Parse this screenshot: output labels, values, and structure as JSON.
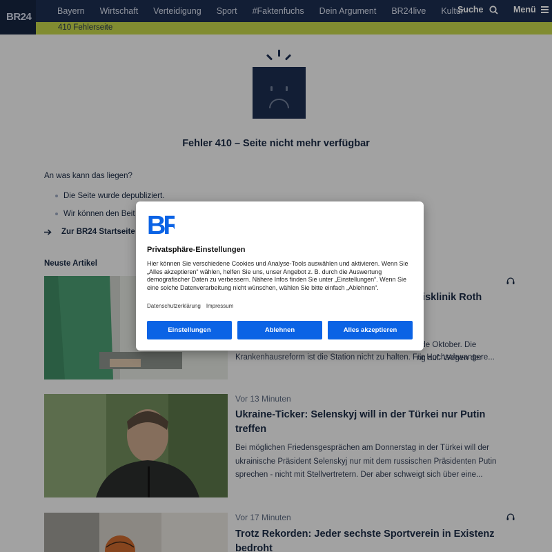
{
  "header": {
    "logo": "BR24",
    "nav": [
      "Bayern",
      "Wirtschaft",
      "Verteidigung",
      "Sport",
      "#Faktenfuchs",
      "Dein Argument",
      "BR24live",
      "Kultur"
    ],
    "search_label": "Suche",
    "menu_label": "Menü",
    "breadcrumb": "410 Fehlerseite"
  },
  "error": {
    "title": "Fehler 410 – Seite nicht mehr verfügbar",
    "question": "An was kann das liegen?",
    "reasons": [
      "Die Seite wurde depubliziert.",
      "Wir können den Beit"
    ],
    "home_link": "Zur BR24 Startseite"
  },
  "articles": {
    "section_title": "Neuste Artikel",
    "items": [
      {
        "meta": "",
        "headline": "eisklinik Roth",
        "teaser": "nde Oktober. Die\nng auf. Wegen der\nKrankenhausreform ist die Station nicht zu halten. Für Hochschwangere..."
      },
      {
        "meta": "Vor 13 Minuten",
        "headline": "Ukraine-Ticker: Selenskyj will in der Türkei nur Putin treffen",
        "teaser": "Bei möglichen Friedensgesprächen am Donnerstag in der Türkei will der ukrainische Präsident Selenskyj nur mit dem russischen Präsidenten Putin sprechen - nicht mit Stellvertretern. Der aber schweigt sich über eine..."
      },
      {
        "meta": "Vor 17 Minuten",
        "headline": "Trotz Rekorden: Jeder sechste Sportverein in Existenz bedroht",
        "teaser": ""
      }
    ]
  },
  "consent": {
    "logo": "BR",
    "title": "Privatsphäre-Einstellungen",
    "text": "Hier können Sie verschiedene Cookies und Analyse-Tools auswählen und aktivieren. Wenn Sie „Alles akzeptieren“ wählen, helfen Sie uns, unser Angebot z. B. durch die Auswertung demografischer Daten zu verbessern. Nähere Infos finden Sie unter „Einstellungen“. Wenn Sie eine solche Datenverarbeitung nicht wünschen, wählen Sie bitte einfach „Ablehnen“.",
    "link_privacy": "Datenschutzerklärung",
    "link_imprint": "Impressum",
    "btn_settings": "Einstellungen",
    "btn_decline": "Ablehnen",
    "btn_accept": "Alles akzeptieren"
  },
  "colors": {
    "nav_bg": "#1c2d4f",
    "breadcrumb_bg": "#c1d14a",
    "consent_button": "#0b63e5"
  }
}
